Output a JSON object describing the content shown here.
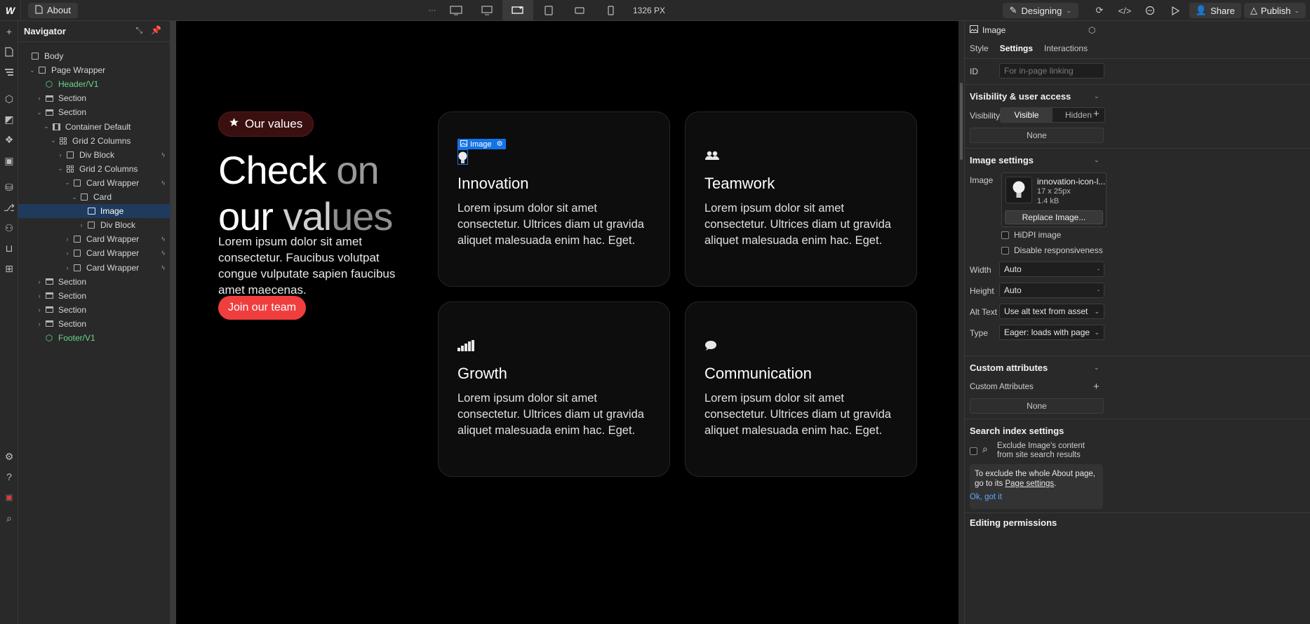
{
  "topbar": {
    "logo": "W",
    "page_name": "About",
    "more": "···",
    "width_label": "1326 PX",
    "mode": "Designing",
    "share": "Share",
    "publish": "Publish"
  },
  "navigator": {
    "title": "Navigator",
    "tree": [
      {
        "label": "Body",
        "depth": 0,
        "icon": "box",
        "chev": ""
      },
      {
        "label": "Page Wrapper",
        "depth": 1,
        "icon": "box",
        "chev": "v"
      },
      {
        "label": "Header/V1",
        "depth": 2,
        "icon": "component",
        "chev": "",
        "green": true
      },
      {
        "label": "Section",
        "depth": 2,
        "icon": "section",
        "chev": ">"
      },
      {
        "label": "Section",
        "depth": 2,
        "icon": "section",
        "chev": "v"
      },
      {
        "label": "Container Default",
        "depth": 3,
        "icon": "container",
        "chev": "v"
      },
      {
        "label": "Grid 2 Columns",
        "depth": 4,
        "icon": "grid",
        "chev": "v"
      },
      {
        "label": "Div Block",
        "depth": 5,
        "icon": "box",
        "chev": ">",
        "bolt": true
      },
      {
        "label": "Grid 2 Columns",
        "depth": 5,
        "icon": "grid",
        "chev": "v"
      },
      {
        "label": "Card Wrapper",
        "depth": 6,
        "icon": "box",
        "chev": "v",
        "bolt": true
      },
      {
        "label": "Card",
        "depth": 7,
        "icon": "box",
        "chev": "v"
      },
      {
        "label": "Image",
        "depth": 8,
        "icon": "image",
        "chev": "",
        "selected": true
      },
      {
        "label": "Div Block",
        "depth": 8,
        "icon": "box",
        "chev": ">"
      },
      {
        "label": "Card Wrapper",
        "depth": 6,
        "icon": "box",
        "chev": ">",
        "bolt": true
      },
      {
        "label": "Card Wrapper",
        "depth": 6,
        "icon": "box",
        "chev": ">",
        "bolt": true
      },
      {
        "label": "Card Wrapper",
        "depth": 6,
        "icon": "box",
        "chev": ">",
        "bolt": true
      },
      {
        "label": "Section",
        "depth": 2,
        "icon": "section",
        "chev": ">"
      },
      {
        "label": "Section",
        "depth": 2,
        "icon": "section",
        "chev": ">"
      },
      {
        "label": "Section",
        "depth": 2,
        "icon": "section",
        "chev": ">"
      },
      {
        "label": "Section",
        "depth": 2,
        "icon": "section",
        "chev": ">"
      },
      {
        "label": "Footer/V1",
        "depth": 2,
        "icon": "component",
        "chev": "",
        "green": true
      }
    ]
  },
  "canvas": {
    "badge": "Our values",
    "title_w1": "Check",
    "title_w2": "on",
    "title_w3": "our",
    "title_w4": "val",
    "title_w5": "ues",
    "hero_text": "Lorem ipsum dolor sit amet consectetur. Faucibus volutpat congue vulputate sapien faucibus amet maecenas.",
    "cta": "Join our team",
    "selection_label": "Image",
    "cards": [
      {
        "title": "Innovation",
        "text": "Lorem ipsum dolor sit amet consectetur. Ultrices diam ut gravida aliquet malesuada enim hac. Eget.",
        "icon": "lightbulb-icon"
      },
      {
        "title": "Teamwork",
        "text": "Lorem ipsum dolor sit amet consectetur. Ultrices diam ut gravida aliquet malesuada enim hac. Eget.",
        "icon": "people-icon"
      },
      {
        "title": "Growth",
        "text": "Lorem ipsum dolor sit amet consectetur. Ultrices diam ut gravida aliquet malesuada enim hac. Eget.",
        "icon": "signal-bars-icon"
      },
      {
        "title": "Communication",
        "text": "Lorem ipsum dolor sit amet consectetur. Ultrices diam ut gravida aliquet malesuada enim hac. Eget.",
        "icon": "chat-bubble-icon"
      }
    ],
    "accent_color": "#f03e3e",
    "selection_color": "#1473e6"
  },
  "panel": {
    "element": "Image",
    "tabs": [
      "Style",
      "Settings",
      "Interactions"
    ],
    "active_tab": "Settings",
    "id_label": "ID",
    "id_placeholder": "For in-page linking",
    "visibility_section": "Visibility & user access",
    "visibility_label": "Visibility",
    "visible": "Visible",
    "hidden": "Hidden",
    "none1": "None",
    "image_settings": "Image settings",
    "image_label": "Image",
    "image_name": "innovation-icon-l...",
    "image_dims": "17 x 25px",
    "image_size": "1.4 kB",
    "replace": "Replace Image...",
    "hidpi": "HiDPI image",
    "disable_resp": "Disable responsiveness",
    "width_label": "Width",
    "width_value": "Auto",
    "height_label": "Height",
    "height_value": "Auto",
    "alt_label": "Alt Text",
    "alt_value": "Use alt text from asset",
    "type_label": "Type",
    "type_value": "Eager: loads with page",
    "custom_attrs": "Custom attributes",
    "custom_attrs_label": "Custom Attributes",
    "none2": "None",
    "search_index": "Search index settings",
    "exclude_text": "Exclude Image's content from site search results",
    "info_text_1": "To exclude the whole About page, go to its",
    "info_link": "Page settings",
    "info_text_2": ".",
    "ok_link": "Ok, got it",
    "editing_permissions": "Editing permissions"
  }
}
